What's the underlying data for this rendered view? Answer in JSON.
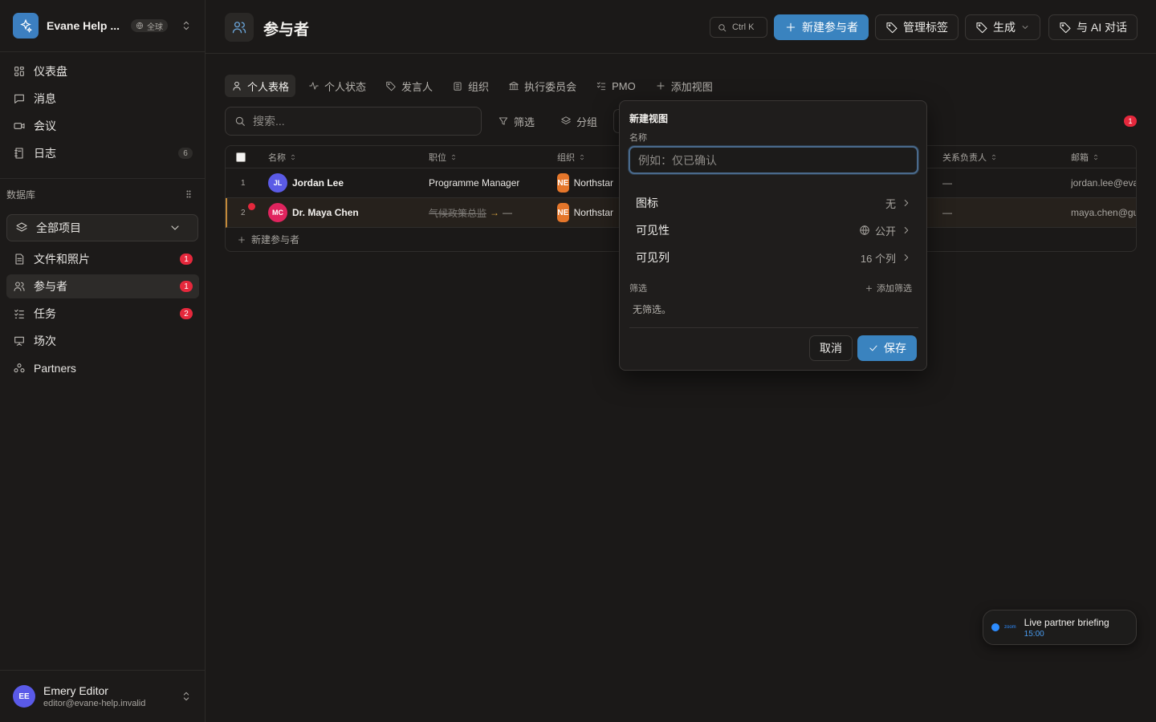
{
  "workspace": {
    "name": "Evane Help ...",
    "badge": "全球"
  },
  "nav": [
    {
      "label": "仪表盘",
      "icon": "dashboard-icon"
    },
    {
      "label": "消息",
      "icon": "message-icon"
    },
    {
      "label": "会议",
      "icon": "video-icon"
    },
    {
      "label": "日志",
      "icon": "journal-icon",
      "count": "6"
    }
  ],
  "database": {
    "label": "数据库",
    "selector": "全部项目",
    "items": [
      {
        "label": "文件和照片",
        "icon": "file-icon",
        "count": "1"
      },
      {
        "label": "参与者",
        "icon": "users-icon",
        "count": "1"
      },
      {
        "label": "任务",
        "icon": "tasks-icon",
        "count": "2"
      },
      {
        "label": "场次",
        "icon": "presentation-icon"
      },
      {
        "label": "Partners",
        "icon": "partners-icon"
      }
    ]
  },
  "user": {
    "name": "Emery Editor",
    "email": "editor@evane-help.invalid",
    "initials": "EE"
  },
  "header": {
    "title": "参与者",
    "shortcut": "Ctrl K",
    "new_btn": "新建参与者",
    "tags_btn": "管理标签",
    "generate_btn": "生成",
    "ai_btn": "与 AI 对话"
  },
  "tabs": [
    {
      "label": "个人表格",
      "icon": "person-icon"
    },
    {
      "label": "个人状态",
      "icon": "activity-icon"
    },
    {
      "label": "发言人",
      "icon": "tag-icon"
    },
    {
      "label": "组织",
      "icon": "building-icon"
    },
    {
      "label": "执行委员会",
      "icon": "bank-icon"
    },
    {
      "label": "PMO",
      "icon": "checklist-icon"
    },
    {
      "label": "添加视图",
      "icon": "plus-icon"
    }
  ],
  "toolbar": {
    "search_placeholder": "搜索...",
    "filter": "筛选",
    "group": "分组",
    "alert_count": "1"
  },
  "table": {
    "columns": {
      "name": "名称",
      "role": "职位",
      "org": "组织",
      "owner": "关系负责人",
      "email": "邮箱"
    },
    "rows": [
      {
        "num": "1",
        "initials": "JL",
        "avatar_color": "#5b5be6",
        "name": "Jordan Lee",
        "role": "Programme Manager",
        "org_tag": "NE",
        "org": "Northstar",
        "owner": "—",
        "email": "jordan.lee@evane"
      },
      {
        "num": "2",
        "initials": "MC",
        "avatar_color": "#e0245e",
        "name": "Dr. Maya Chen",
        "role_old": "气候政策总监",
        "role_new": "—",
        "org_tag": "NE",
        "org": "Northstar",
        "owner": "—",
        "email": "maya.chen@gu"
      }
    ],
    "new_row": "新建参与者"
  },
  "popover": {
    "title": "新建视图",
    "name_label": "名称",
    "name_placeholder": "例如：仅已确认",
    "icon_label": "图标",
    "icon_value": "无",
    "visibility_label": "可见性",
    "visibility_value": "公开",
    "columns_label": "可见列",
    "columns_value": "16 个列",
    "filter_label": "筛选",
    "add_filter": "添加筛选",
    "no_filter": "无筛选。",
    "cancel": "取消",
    "save": "保存"
  },
  "meeting": {
    "brand": "zoom",
    "title": "Live partner briefing",
    "time": "15:00"
  },
  "colors": {
    "accent": "#3a83bf",
    "alert": "#e5283c",
    "org_tag": "#e5762a"
  }
}
